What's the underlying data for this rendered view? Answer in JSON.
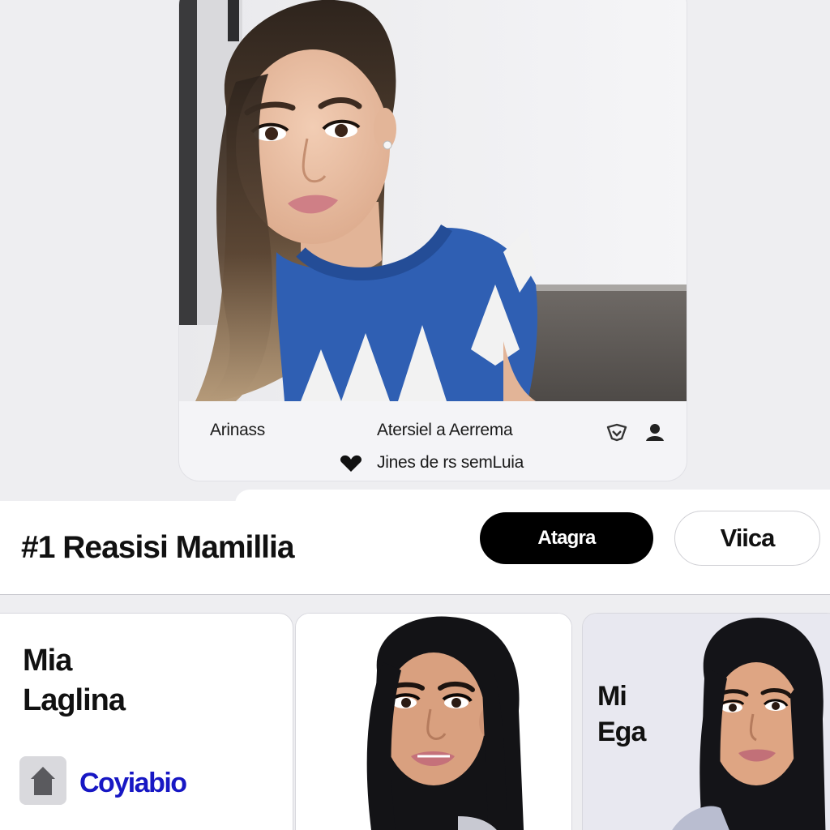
{
  "profile_card": {
    "meta_left": "Arinass",
    "meta_center": "Atersiel a Aerrema",
    "like_text": "Jines de rs semLuia",
    "icons": [
      "heart-icon",
      "shield-icon",
      "person-icon"
    ]
  },
  "header": {
    "title": "#1 Reasisi Mamillia",
    "primary_button": "Atagra",
    "secondary_button": "Viica"
  },
  "cards": [
    {
      "name_line1": "Mia",
      "name_line2": "Laglina",
      "link_text": "Coyiabio",
      "icon": "home-icon"
    },
    {
      "photo": "portrait"
    },
    {
      "name_line1": "Mi",
      "name_line2": "Ega",
      "photo": "portrait"
    }
  ],
  "colors": {
    "background": "#eeeef1",
    "primary_button": "#000000",
    "link": "#1717c4",
    "sweater": "#2f5fb3"
  }
}
